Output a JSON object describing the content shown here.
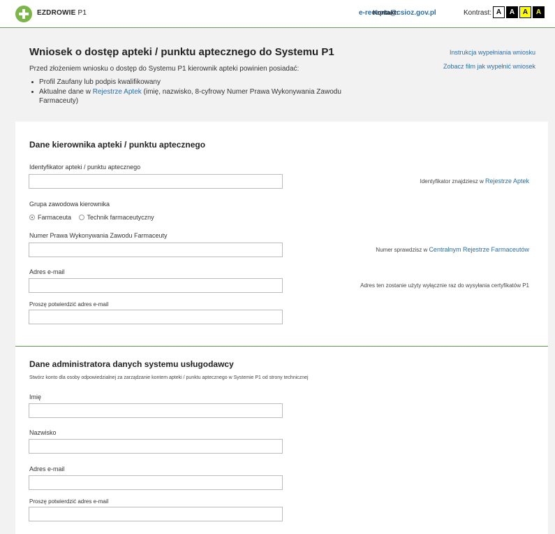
{
  "header": {
    "brand": "EZDROWIE",
    "brand_suffix": "P1",
    "contact_label": "Kontakt:",
    "contact_email": "e-recepta@csioz.gov.pl",
    "contrast_label": "Kontrast:",
    "contrast_buttons": [
      "A",
      "A",
      "A",
      "A"
    ]
  },
  "intro": {
    "title": "Wniosek o dostęp apteki / punktu aptecznego do Systemu P1",
    "paragraph": "Przed złożeniem wniosku o dostęp do Systemu P1 kierownik apteki powinien posiadać:",
    "req1": "Profil Zaufany lub podpis kwalifikowany",
    "req2_before": "Aktualne dane w ",
    "req2_link": "Rejestrze Aptek",
    "req2_after": " (imię, nazwisko, 8-cyfrowy Numer Prawa Wykonywania Zawodu Farmaceuty)",
    "link_instruction": "Instrukcja wypełniania wniosku",
    "link_video": "Zobacz film jak wypełnić wniosek"
  },
  "section1": {
    "title": "Dane kierownika apteki / punktu aptecznego",
    "pharmacy_id_label": "Identyfikator apteki / punktu aptecznego",
    "pharmacy_id_value": "",
    "pharmacy_id_hint": "Identyfikator znajdziesz w ",
    "pharmacy_id_hint_link": "Rejestrze Aptek",
    "group_label": "Grupa zawodowa kierownika",
    "group_options": [
      "Farmaceuta",
      "Technik farmaceutyczny"
    ],
    "npwz_label": "Numer Prawa Wykonywania Zawodu Farmaceuty",
    "npwz_value": "",
    "npwz_hint": "Numer sprawdzisz w ",
    "npwz_hint_link": "Centralnym Rejestrze Farmaceutów",
    "email_label": "Adres e-mail",
    "email_value": "",
    "email_hint": "Adres ten zostanie użyty wyłącznie raz do wysyłania certyfikatów P1",
    "email_confirm_label": "Proszę potwierdzić adres e-mail",
    "email_confirm_value": ""
  },
  "section2": {
    "title": "Dane administratora danych systemu usługodawcy",
    "description": "Stwórz konto dla osoby odpowiedzialnej za zarządzanie kontem apteki / punktu aptecznego w Systemie P1 od strony technicznej",
    "first_name_label": "Imię",
    "first_name_value": "",
    "last_name_label": "Nazwisko",
    "last_name_value": "",
    "email_label": "Adres e-mail",
    "email_value": "",
    "email_confirm_label": "Proszę potwierdzić adres e-mail",
    "email_confirm_value": ""
  },
  "colors": {
    "accent_green": "#7ab648",
    "link_blue": "#2a6ea8"
  }
}
